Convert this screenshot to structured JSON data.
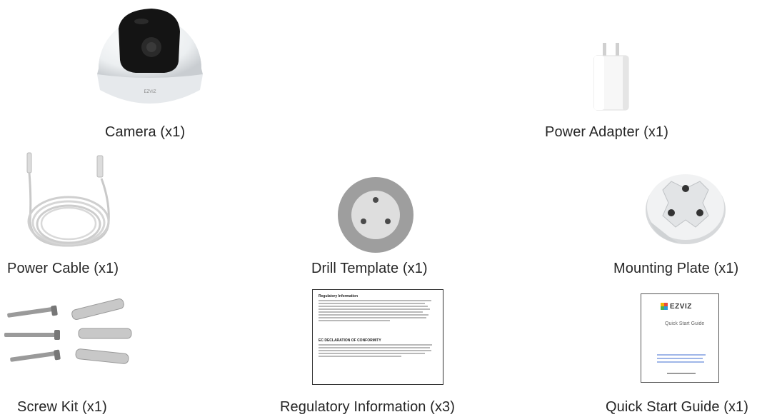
{
  "items": {
    "camera": "Camera (x1)",
    "power_adapter": "Power Adapter (x1)",
    "power_cable": "Power Cable (x1)",
    "drill_template": "Drill Template (x1)",
    "mounting_plate": "Mounting Plate (x1)",
    "screw_kit": "Screw Kit (x1)",
    "regulatory_info": "Regulatory Information (x3)",
    "quick_start_guide": "Quick Start Guide (x1)"
  },
  "camera_brand": "EZVIZ",
  "regulatory_doc": {
    "title": "Regulatory Information",
    "section": "EC DECLARATION OF CONFORMITY"
  },
  "quick_start_doc": {
    "brand": "EZVIZ",
    "title": "Quick Start Guide"
  }
}
